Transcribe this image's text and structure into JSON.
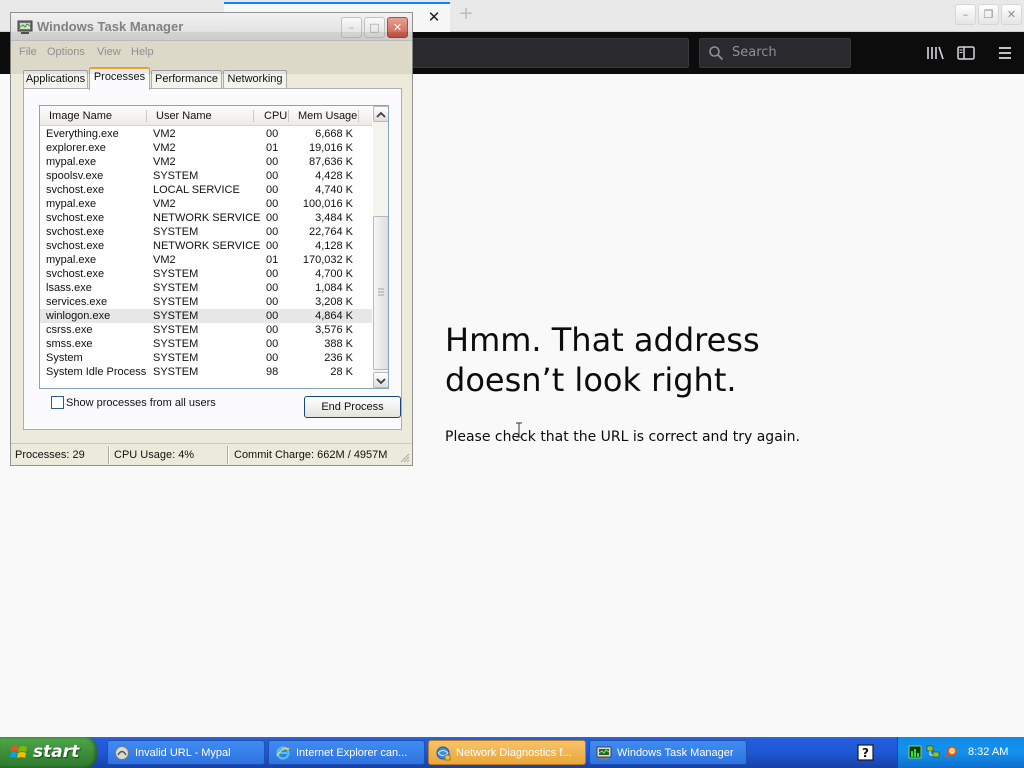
{
  "browser": {
    "tab_close_glyph": "✕",
    "new_tab_glyph": "+",
    "search_placeholder": "Search",
    "window_controls": {
      "minimize": "–",
      "restore": "❐",
      "close": "✕"
    },
    "error": {
      "title_line1": "Hmm. That address",
      "title_line2": "doesn’t look right.",
      "description": "Please check that the URL is correct and try again."
    }
  },
  "task_manager": {
    "title": "Windows Task Manager",
    "controls": {
      "minimize": "–",
      "maximize": "□",
      "close": "✕"
    },
    "menu": [
      "File",
      "Options",
      "View",
      "Help"
    ],
    "tabs": [
      "Applications",
      "Processes",
      "Performance",
      "Networking"
    ],
    "active_tab": "Processes",
    "columns": [
      "Image Name",
      "User Name",
      "CPU",
      "Mem Usage"
    ],
    "processes": [
      {
        "name": "Everything.exe",
        "user": "VM2",
        "cpu": "00",
        "mem": "6,668 K"
      },
      {
        "name": "explorer.exe",
        "user": "VM2",
        "cpu": "01",
        "mem": "19,016 K"
      },
      {
        "name": "mypal.exe",
        "user": "VM2",
        "cpu": "00",
        "mem": "87,636 K"
      },
      {
        "name": "spoolsv.exe",
        "user": "SYSTEM",
        "cpu": "00",
        "mem": "4,428 K"
      },
      {
        "name": "svchost.exe",
        "user": "LOCAL SERVICE",
        "cpu": "00",
        "mem": "4,740 K"
      },
      {
        "name": "mypal.exe",
        "user": "VM2",
        "cpu": "00",
        "mem": "100,016 K"
      },
      {
        "name": "svchost.exe",
        "user": "NETWORK SERVICE",
        "cpu": "00",
        "mem": "3,484 K"
      },
      {
        "name": "svchost.exe",
        "user": "SYSTEM",
        "cpu": "00",
        "mem": "22,764 K"
      },
      {
        "name": "svchost.exe",
        "user": "NETWORK SERVICE",
        "cpu": "00",
        "mem": "4,128 K"
      },
      {
        "name": "mypal.exe",
        "user": "VM2",
        "cpu": "01",
        "mem": "170,032 K"
      },
      {
        "name": "svchost.exe",
        "user": "SYSTEM",
        "cpu": "00",
        "mem": "4,700 K"
      },
      {
        "name": "lsass.exe",
        "user": "SYSTEM",
        "cpu": "00",
        "mem": "1,084 K"
      },
      {
        "name": "services.exe",
        "user": "SYSTEM",
        "cpu": "00",
        "mem": "3,208 K"
      },
      {
        "name": "winlogon.exe",
        "user": "SYSTEM",
        "cpu": "00",
        "mem": "4,864 K",
        "selected": true
      },
      {
        "name": "csrss.exe",
        "user": "SYSTEM",
        "cpu": "00",
        "mem": "3,576 K"
      },
      {
        "name": "smss.exe",
        "user": "SYSTEM",
        "cpu": "00",
        "mem": "388 K"
      },
      {
        "name": "System",
        "user": "SYSTEM",
        "cpu": "00",
        "mem": "236 K"
      },
      {
        "name": "System Idle Process",
        "user": "SYSTEM",
        "cpu": "98",
        "mem": "28 K"
      }
    ],
    "show_all_users_label": "Show processes from all users",
    "show_all_users_checked": false,
    "end_process_label": "End Process",
    "status": {
      "processes": "Processes: 29",
      "cpu_usage": "CPU Usage: 4%",
      "commit_charge": "Commit Charge: 662M / 4957M"
    }
  },
  "taskbar": {
    "start_label": "start",
    "tasks": [
      {
        "label": "Invalid URL - Mypal",
        "icon": "mypal-icon",
        "active": false
      },
      {
        "label": "Internet Explorer can...",
        "icon": "ie-icon",
        "active": false
      },
      {
        "label": "Network Diagnostics f...",
        "icon": "network-diagnostics-icon",
        "active": true
      },
      {
        "label": "Windows Task Manager",
        "icon": "task-manager-icon",
        "active": false
      }
    ],
    "tray_icons": [
      "task-manager-tray-icon",
      "network-tray-icon",
      "search-tray-icon"
    ],
    "clock": "8:32 AM"
  },
  "colors": {
    "browser_toolbar": "#0c0c0d",
    "tab_accent": "#0a84ff",
    "xp_taskbar": "#245edb",
    "xp_start": "#3c8f3a",
    "active_task": "#e9a63a"
  }
}
